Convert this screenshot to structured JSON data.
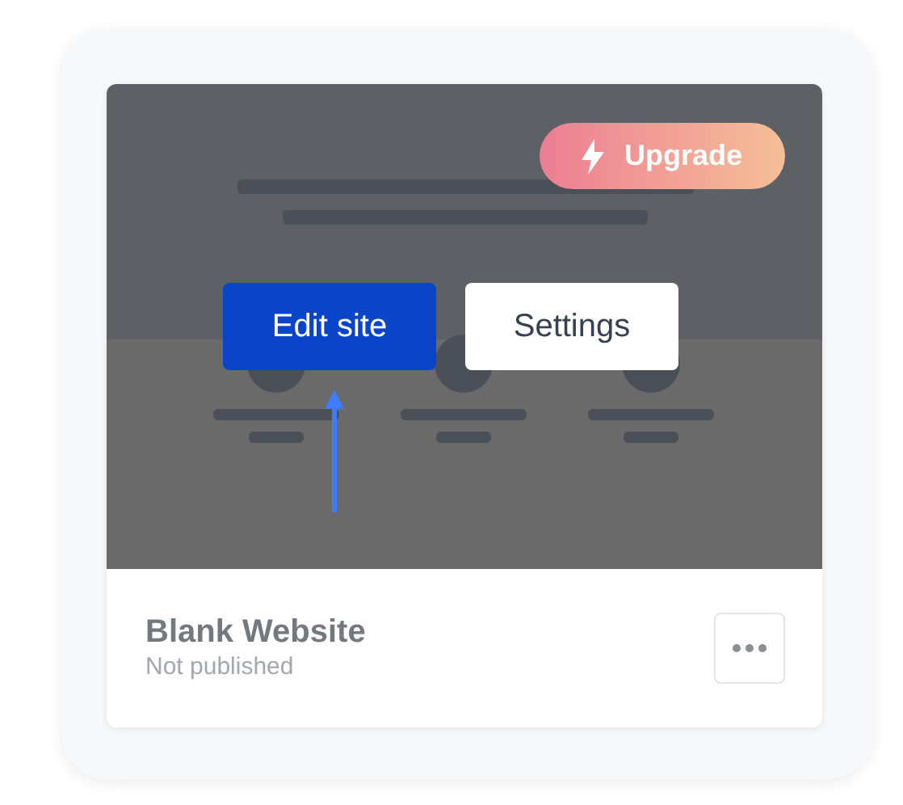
{
  "site_card": {
    "badge": {
      "label": "Upgrade"
    },
    "buttons": [
      {
        "label": "Edit site",
        "kind": "primary"
      },
      {
        "label": "Settings",
        "kind": "secondary"
      }
    ],
    "title": "Blank Website",
    "status": "Not published"
  }
}
